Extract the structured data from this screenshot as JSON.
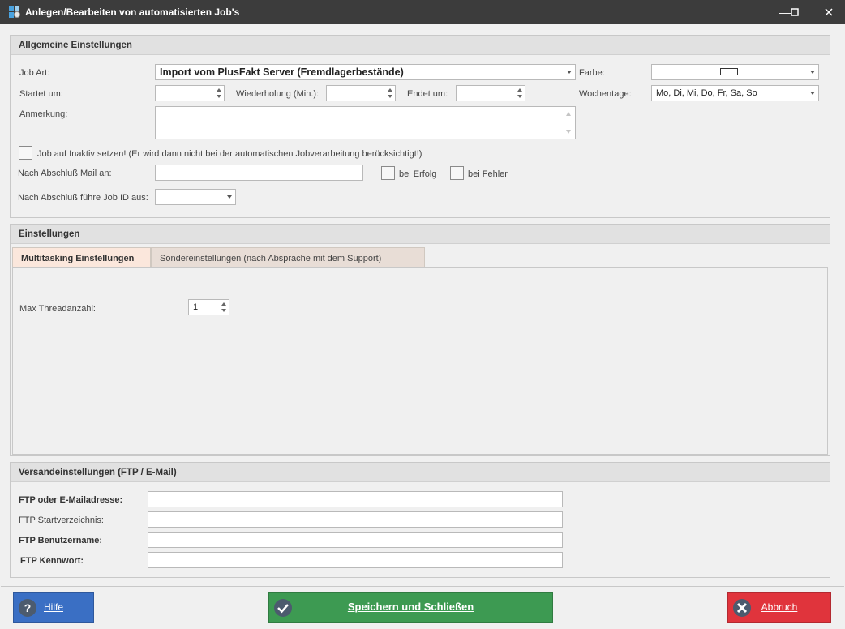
{
  "window": {
    "title": "Anlegen/Bearbeiten von automatisierten Job's",
    "minimize_icon": "minimize-icon",
    "maximize_icon": "maximize-icon",
    "close_icon": "close-icon"
  },
  "general": {
    "header": "Allgemeine Einstellungen",
    "job_art_label": "Job Art:",
    "job_art_value": "Import vom PlusFakt Server (Fremdlagerbestände)",
    "farbe_label": "Farbe:",
    "startet_label": "Startet um:",
    "startet_value": "",
    "wiederholung_label": "Wiederholung (Min.):",
    "wiederholung_value": "",
    "endet_label": "Endet um:",
    "endet_value": "",
    "wochentage_label": "Wochentage:",
    "wochentage_value": "Mo, Di, Mi, Do, Fr, Sa, So",
    "anmerkung_label": "Anmerkung:",
    "anmerkung_value": "",
    "inaktiv_label": "Job auf Inaktiv setzen! (Er wird dann nicht bei der automatischen Jobverarbeitung berücksichtigt!)",
    "mail_label": "Nach Abschluß Mail an:",
    "mail_value": "",
    "erfolg_label": "bei Erfolg",
    "fehler_label": "bei Fehler",
    "job_id_label": "Nach Abschluß führe Job ID aus:",
    "job_id_value": ""
  },
  "settings": {
    "header": "Einstellungen",
    "tabs": [
      {
        "label": "Multitasking Einstellungen",
        "active": true
      },
      {
        "label": "Sondereinstellungen (nach Absprache mit dem Support)",
        "active": false
      }
    ],
    "max_thread_label": "Max Threadanzahl:",
    "max_thread_value": "1"
  },
  "shipping": {
    "header": "Versandeinstellungen (FTP / E-Mail)",
    "ftp_address_label": "FTP oder E-Mailadresse:",
    "ftp_address_value": "",
    "ftp_dir_label": "FTP Startverzeichnis:",
    "ftp_dir_value": "",
    "ftp_user_label": "FTP Benutzername:",
    "ftp_user_value": "",
    "ftp_pass_label": "FTP Kennwort:",
    "ftp_pass_value": ""
  },
  "buttons": {
    "help_label": "Hilfe",
    "save_label": "Speichern und Schließen",
    "cancel_label": "Abbruch"
  },
  "colors": {
    "help_bg": "#3a6fc4",
    "save_bg": "#3d9a52",
    "cancel_bg": "#e0343c"
  }
}
